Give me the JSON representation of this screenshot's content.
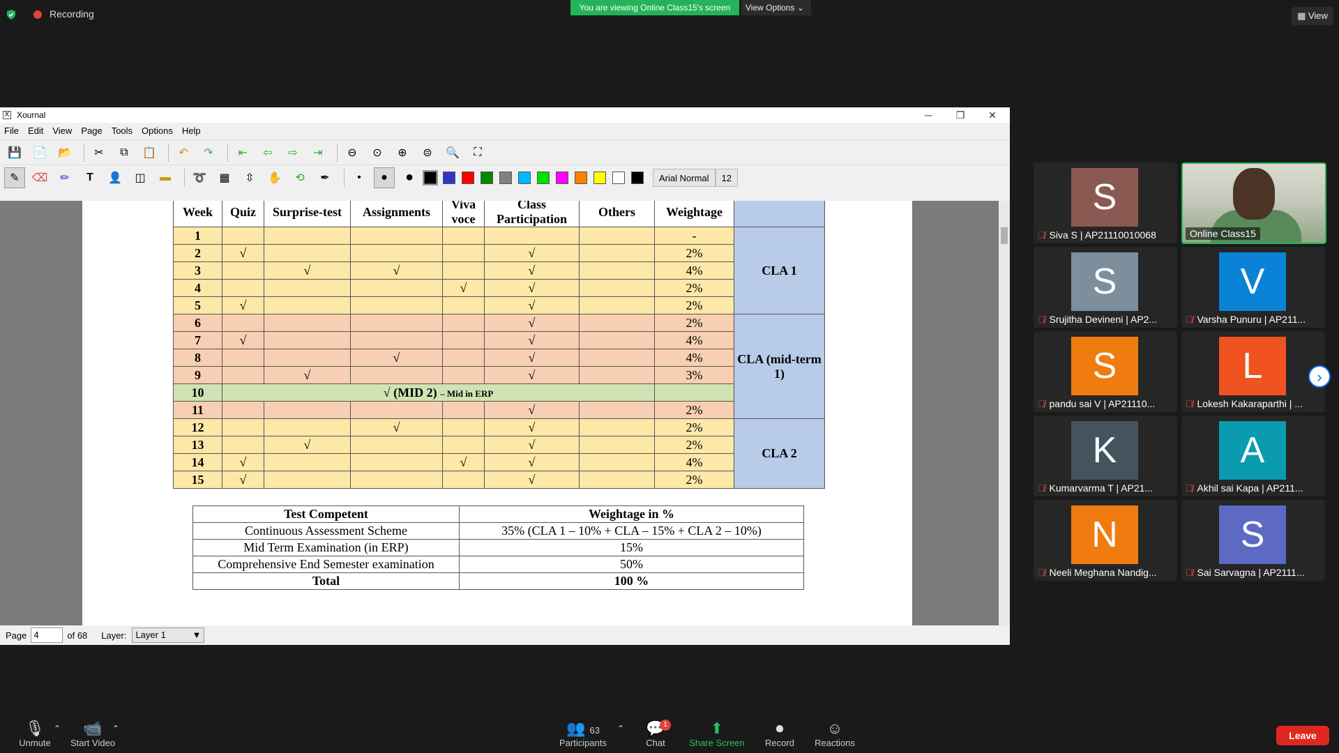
{
  "zoom": {
    "recording_label": "Recording",
    "viewing_banner": "You are viewing Online Class15's screen",
    "view_options": "View Options",
    "view_button": "View"
  },
  "xournal": {
    "title": "Xournal",
    "menu": [
      "File",
      "Edit",
      "View",
      "Page",
      "Tools",
      "Options",
      "Help"
    ],
    "font_name": "Arial Normal",
    "font_size": "12",
    "colors": [
      "#000000",
      "#3333cc",
      "#ff0000",
      "#008a00",
      "#808080",
      "#00b7ff",
      "#00e000",
      "#ff00ff",
      "#ff8000",
      "#ffff00",
      "#ffffff",
      "#000000"
    ],
    "status": {
      "page_label": "Page",
      "page_value": "4",
      "of_pages": "of 68",
      "layer_label": "Layer:",
      "layer_value": "Layer 1"
    }
  },
  "week_table": {
    "headers": [
      "Week",
      "Quiz",
      "Surprise-test",
      "Assignments",
      "Viva voce",
      "Class Participation",
      "Others",
      "Weightage",
      ""
    ],
    "rows": [
      {
        "week": "1",
        "quiz": "",
        "surprise": "",
        "assign": "",
        "viva": "",
        "cp": "",
        "others": "",
        "wt": "-",
        "tone": "y"
      },
      {
        "week": "2",
        "quiz": "√",
        "surprise": "",
        "assign": "",
        "viva": "",
        "cp": "√",
        "others": "",
        "wt": "2%",
        "tone": "y"
      },
      {
        "week": "3",
        "quiz": "",
        "surprise": "√",
        "assign": "√",
        "viva": "",
        "cp": "√",
        "others": "",
        "wt": "4%",
        "tone": "y"
      },
      {
        "week": "4",
        "quiz": "",
        "surprise": "",
        "assign": "",
        "viva": "√",
        "cp": "√",
        "others": "",
        "wt": "2%",
        "tone": "y"
      },
      {
        "week": "5",
        "quiz": "√",
        "surprise": "",
        "assign": "",
        "viva": "",
        "cp": "√",
        "others": "",
        "wt": "2%",
        "tone": "y"
      },
      {
        "week": "6",
        "quiz": "",
        "surprise": "",
        "assign": "",
        "viva": "",
        "cp": "√",
        "others": "",
        "wt": "2%",
        "tone": "p"
      },
      {
        "week": "7",
        "quiz": "√",
        "surprise": "",
        "assign": "",
        "viva": "",
        "cp": "√",
        "others": "",
        "wt": "4%",
        "tone": "p"
      },
      {
        "week": "8",
        "quiz": "",
        "surprise": "",
        "assign": "√",
        "viva": "",
        "cp": "√",
        "others": "",
        "wt": "4%",
        "tone": "p"
      },
      {
        "week": "9",
        "quiz": "",
        "surprise": "√",
        "assign": "",
        "viva": "",
        "cp": "√",
        "others": "",
        "wt": "3%",
        "tone": "p"
      },
      {
        "week": "11",
        "quiz": "",
        "surprise": "",
        "assign": "",
        "viva": "",
        "cp": "√",
        "others": "",
        "wt": "2%",
        "tone": "p"
      },
      {
        "week": "12",
        "quiz": "",
        "surprise": "",
        "assign": "√",
        "viva": "",
        "cp": "√",
        "others": "",
        "wt": "2%",
        "tone": "y"
      },
      {
        "week": "13",
        "quiz": "",
        "surprise": "√",
        "assign": "",
        "viva": "",
        "cp": "√",
        "others": "",
        "wt": "2%",
        "tone": "y"
      },
      {
        "week": "14",
        "quiz": "√",
        "surprise": "",
        "assign": "",
        "viva": "√",
        "cp": "√",
        "others": "",
        "wt": "4%",
        "tone": "y"
      },
      {
        "week": "15",
        "quiz": "√",
        "surprise": "",
        "assign": "",
        "viva": "",
        "cp": "√",
        "others": "",
        "wt": "2%",
        "tone": "y"
      }
    ],
    "mid_row": {
      "week": "10",
      "text": "√ (MID 2)",
      "suffix": "– Mid in ERP"
    },
    "cla_groups": [
      "CLA 1",
      "CLA (mid-term 1)",
      "CLA 2"
    ]
  },
  "summary_table": {
    "headers": [
      "Test Competent",
      "Weightage in %"
    ],
    "rows": [
      [
        "Continuous Assessment Scheme",
        "35% (CLA 1 – 10% + CLA – 15% + CLA 2 – 10%)"
      ],
      [
        "Mid Term Examination (in ERP)",
        "15%"
      ],
      [
        "Comprehensive End Semester examination",
        "50%"
      ],
      [
        "Total",
        "100 %"
      ]
    ]
  },
  "participants": [
    {
      "initial": "S",
      "name": "Siva S | AP21110010068",
      "color": "#8a5a52"
    },
    {
      "initial": "",
      "name": "Online Class15",
      "color": "",
      "video": true
    },
    {
      "initial": "S",
      "name": "Srujitha Devineni | AP2...",
      "color": "#7d8e9c"
    },
    {
      "initial": "V",
      "name": "Varsha Punuru | AP211...",
      "color": "#0a83d6"
    },
    {
      "initial": "S",
      "name": "pandu sai V | AP21110...",
      "color": "#f07c0f"
    },
    {
      "initial": "L",
      "name": "Lokesh Kakaraparthi | ...",
      "color": "#f0531f"
    },
    {
      "initial": "K",
      "name": "Kumarvarma T | AP21...",
      "color": "#44545f"
    },
    {
      "initial": "A",
      "name": "Akhil sai Kapa | AP211...",
      "color": "#0a9bb0"
    },
    {
      "initial": "N",
      "name": "Neeli Meghana Nandig...",
      "color": "#f07c0f"
    },
    {
      "initial": "S",
      "name": "Sai Sarvagna | AP2111...",
      "color": "#5c6ac4"
    }
  ],
  "bottom": {
    "unmute": "Unmute",
    "start_video": "Start Video",
    "participants": "Participants",
    "participants_count": "63",
    "chat": "Chat",
    "chat_badge": "1",
    "share_screen": "Share Screen",
    "record": "Record",
    "reactions": "Reactions",
    "leave": "Leave"
  }
}
